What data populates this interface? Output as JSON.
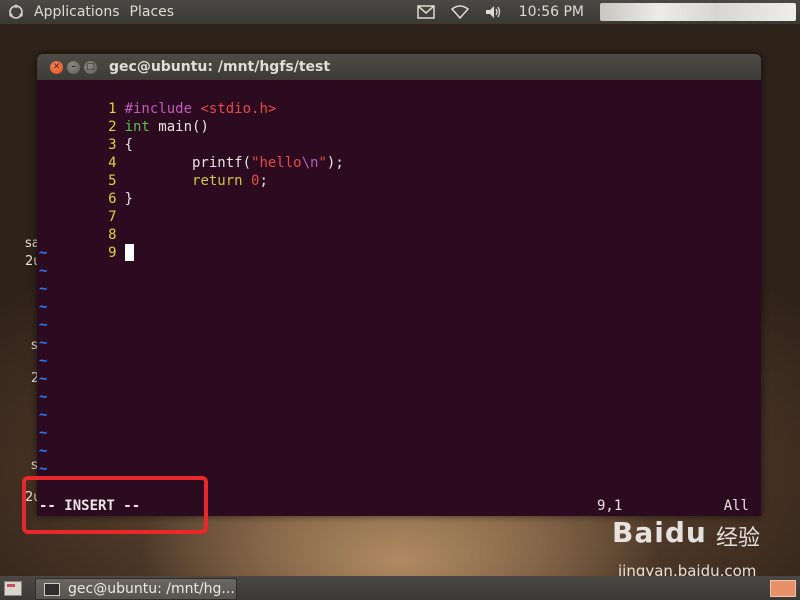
{
  "top_panel": {
    "menus": [
      "Applications",
      "Places"
    ],
    "clock": "10:56 PM",
    "tray_icons": [
      "mail-icon",
      "wifi-icon",
      "volume-icon"
    ]
  },
  "desktop_fragments": [
    "sa",
    "2u",
    "s",
    "2",
    "s",
    "2u"
  ],
  "window": {
    "title": "gec@ubuntu: /mnt/hgfs/test"
  },
  "editor": {
    "lines": [
      {
        "n": "1",
        "text": "#include <stdio.h>"
      },
      {
        "n": "2",
        "text": "int main()"
      },
      {
        "n": "3",
        "text": "{"
      },
      {
        "n": "4",
        "text": "        printf(\"hello\\n\");"
      },
      {
        "n": "5",
        "text": "        return 0;"
      },
      {
        "n": "6",
        "text": "}"
      },
      {
        "n": "7",
        "text": ""
      },
      {
        "n": "8",
        "text": ""
      },
      {
        "n": "9",
        "text": ""
      }
    ],
    "tilde_char": "~",
    "tilde_count": 13,
    "mode": "-- INSERT --",
    "cursor_pos": "9,1",
    "scroll": "All"
  },
  "watermark": {
    "logo": "Baidu",
    "cn": "经验",
    "url": "jingyan.baidu.com"
  },
  "taskbar": {
    "task_label": "gec@ubuntu: /mnt/hg..."
  },
  "colors": {
    "terminal_bg": "#2c0a1f",
    "line_number": "#dcd63e",
    "preprocessor": "#c05cc0",
    "string": "#e44a4a",
    "type": "#56c050",
    "tilde": "#2b7bff",
    "highlight": "#e8282a"
  }
}
